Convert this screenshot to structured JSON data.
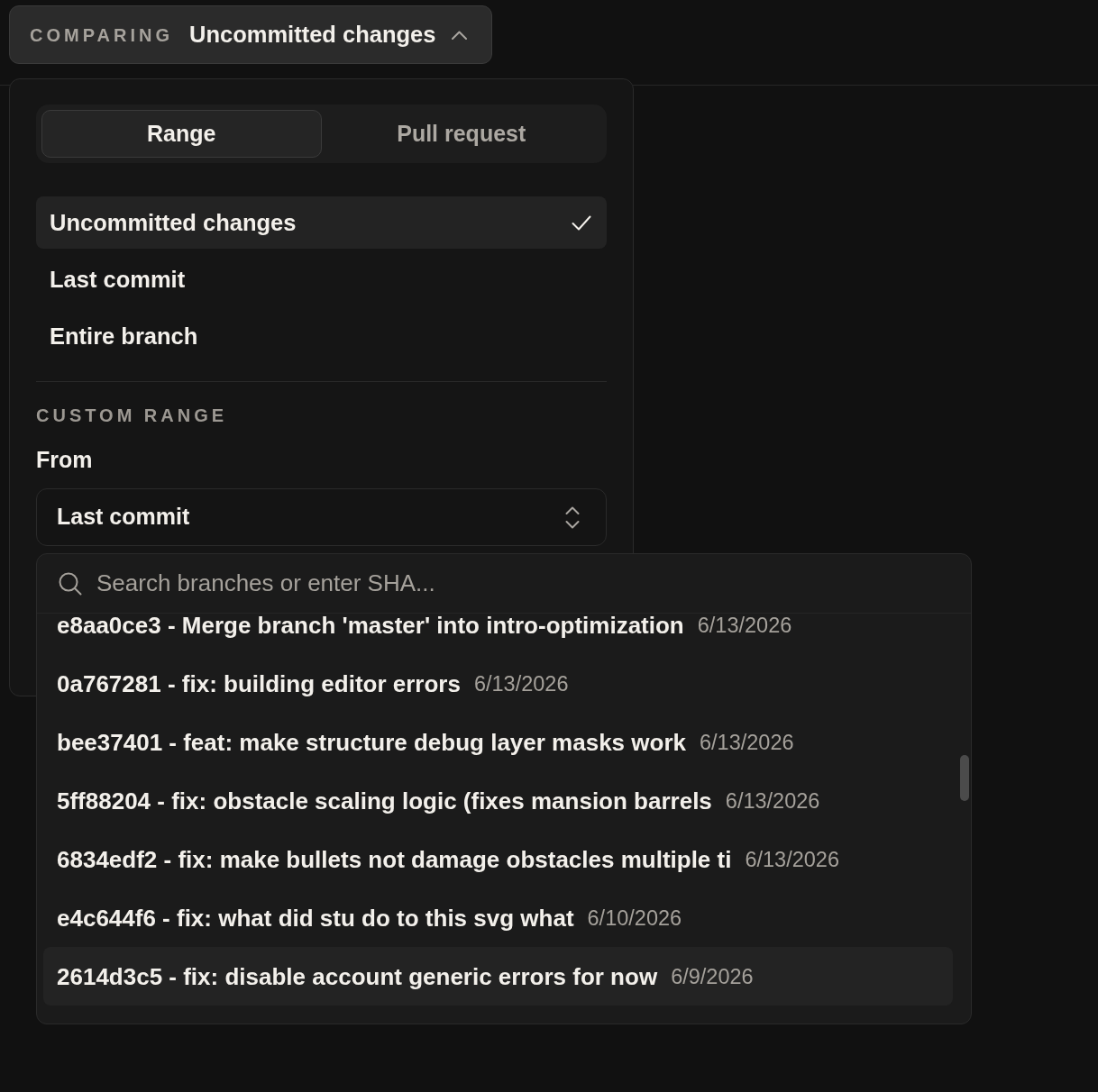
{
  "compare_button": {
    "label": "COMPARING",
    "value": "Uncommitted changes",
    "expanded": true
  },
  "popover": {
    "tabs": [
      {
        "label": "Range",
        "selected": true
      },
      {
        "label": "Pull request",
        "selected": false
      }
    ],
    "options": [
      {
        "label": "Uncommitted changes",
        "selected": true
      },
      {
        "label": "Last commit",
        "selected": false
      },
      {
        "label": "Entire branch",
        "selected": false
      }
    ],
    "custom_range": {
      "heading": "CUSTOM RANGE",
      "from_label": "From",
      "from_value": "Last commit"
    }
  },
  "commit_picker": {
    "search": {
      "placeholder": "Search branches or enter SHA..."
    },
    "commits": [
      {
        "title": "e8aa0ce3 - Merge branch 'master' into intro-optimization",
        "date": "6/13/2026",
        "highlighted": false
      },
      {
        "title": "0a767281 - fix: building editor errors",
        "date": "6/13/2026",
        "highlighted": false
      },
      {
        "title": "bee37401 - feat: make structure debug layer masks work",
        "date": "6/13/2026",
        "highlighted": false
      },
      {
        "title": "5ff88204 - fix: obstacle scaling logic (fixes mansion barrels",
        "date": "6/13/2026",
        "highlighted": false
      },
      {
        "title": "6834edf2 - fix: make bullets not damage obstacles multiple ti",
        "date": "6/13/2026",
        "highlighted": false
      },
      {
        "title": "e4c644f6 - fix: what did stu do to this svg what",
        "date": "6/10/2026",
        "highlighted": false
      },
      {
        "title": "2614d3c5 - fix: disable account generic errors for now",
        "date": "6/9/2026",
        "highlighted": true
      }
    ]
  }
}
